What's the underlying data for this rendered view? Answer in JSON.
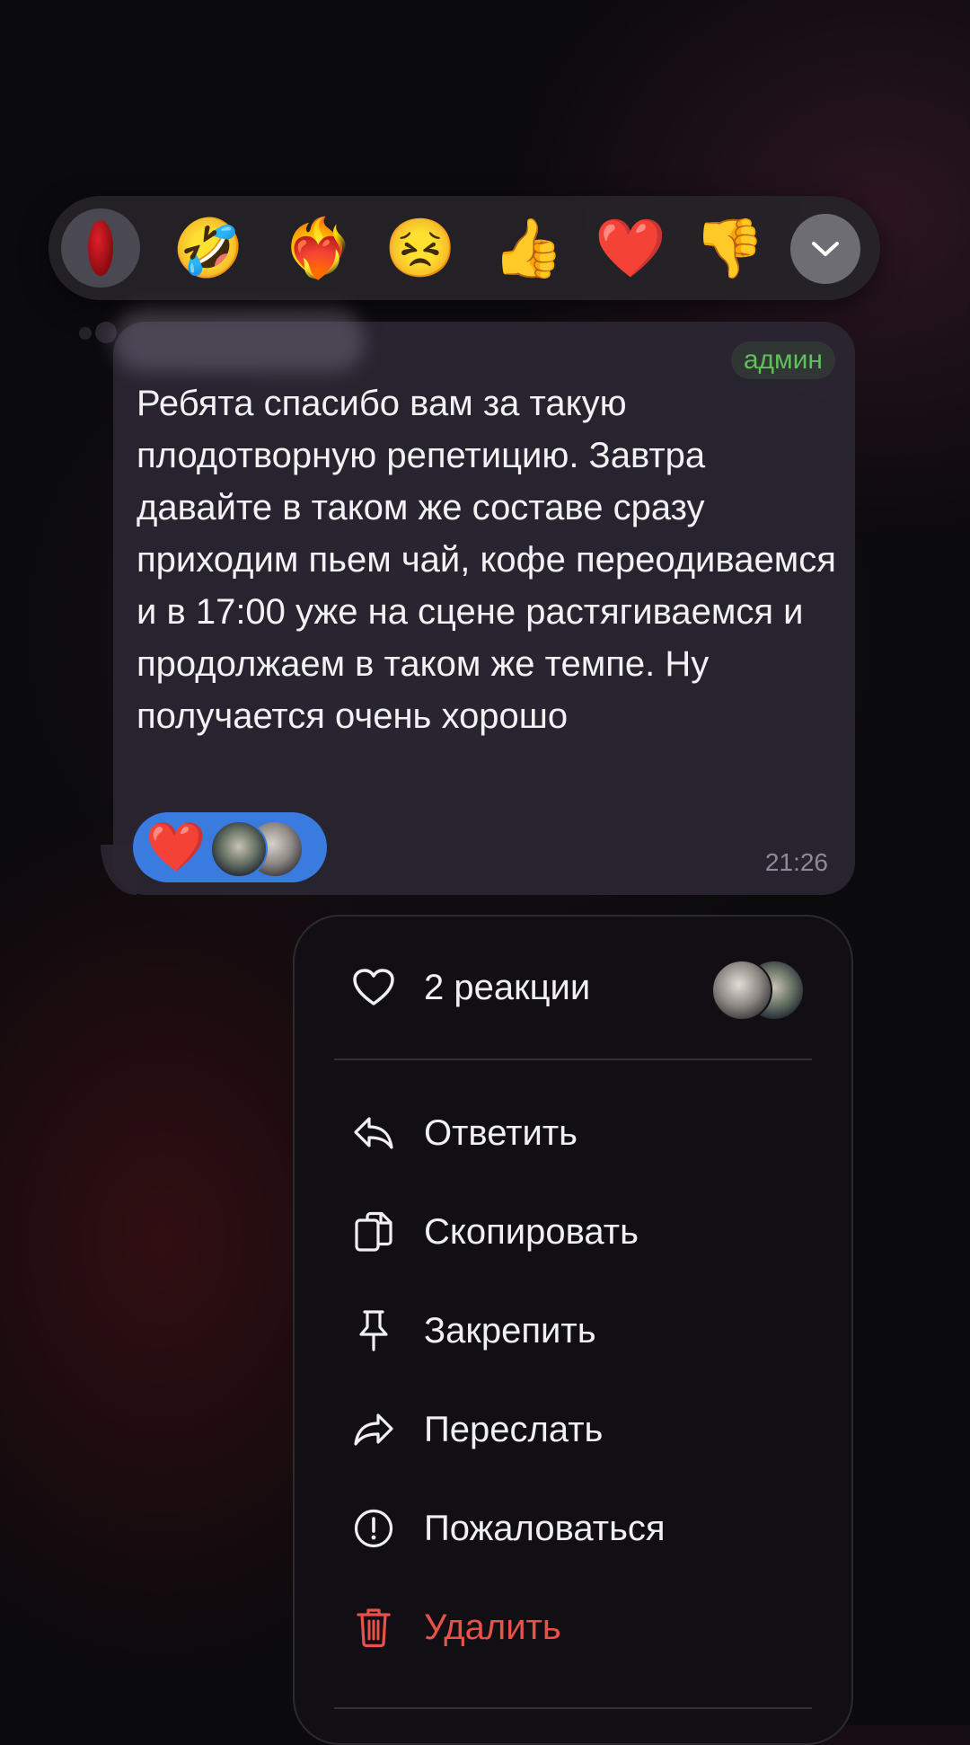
{
  "reaction_bar": {
    "reactions": [
      {
        "name": "red-heart",
        "glyph": "",
        "selected": true
      },
      {
        "name": "rofl",
        "glyph": "🤣"
      },
      {
        "name": "heart-on-fire",
        "glyph": "❤️‍🔥"
      },
      {
        "name": "persevering-face",
        "glyph": "😣"
      },
      {
        "name": "thumbs-up",
        "glyph": "👍"
      },
      {
        "name": "heart",
        "glyph": "❤️"
      },
      {
        "name": "thumbs-down",
        "glyph": "👎"
      }
    ]
  },
  "message": {
    "badge": "админ",
    "text": "Ребята спасибо вам за такую плодотворную репетицию. Завтра давайте в таком же составе сразу приходим пьем чай, кофе переодиваемся и в 17:00 уже на сцене растягиваемся и продолжаем в таком же темпе. Ну получается очень хорошо",
    "reaction_glyph": "❤️",
    "time": "21:26"
  },
  "menu": {
    "reactions_label": "2 реакции",
    "items": [
      {
        "label": "Ответить",
        "icon": "reply-icon"
      },
      {
        "label": "Скопировать",
        "icon": "copy-icon"
      },
      {
        "label": "Закрепить",
        "icon": "pin-icon"
      },
      {
        "label": "Переслать",
        "icon": "forward-icon"
      },
      {
        "label": "Пожаловаться",
        "icon": "report-icon"
      },
      {
        "label": "Удалить",
        "icon": "trash-icon",
        "danger": true
      }
    ]
  },
  "colors": {
    "accent_blue": "#3a7be0",
    "admin_green": "#5fbf5a",
    "danger_red": "#e8524a"
  }
}
